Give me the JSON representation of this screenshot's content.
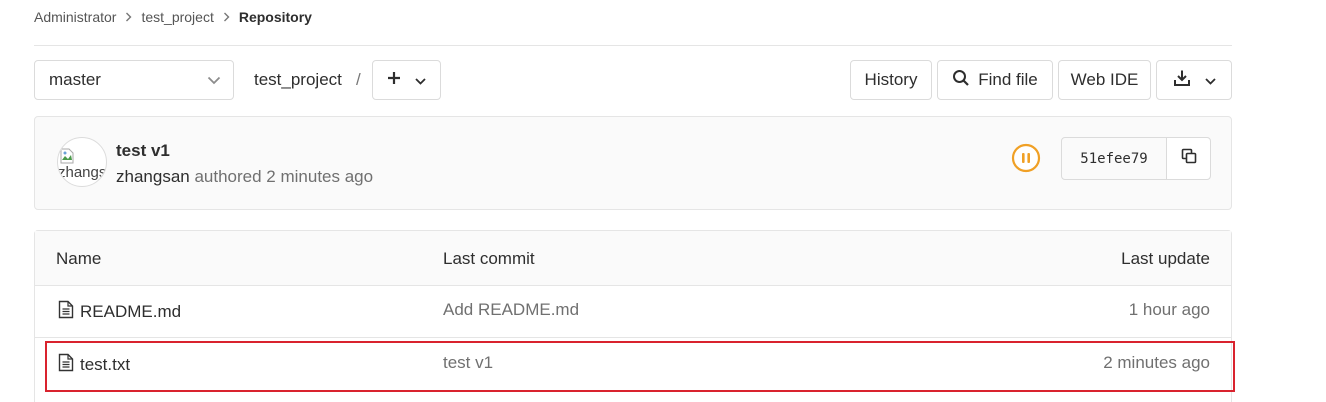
{
  "breadcrumb": {
    "items": [
      "Administrator",
      "test_project"
    ],
    "current": "Repository"
  },
  "toolbar": {
    "branch": "master",
    "project_path": "test_project",
    "path_separator": "/",
    "history_label": "History",
    "find_file_label": "Find file",
    "web_ide_label": "Web IDE"
  },
  "commit": {
    "title": "test v1",
    "author": "zhangsan",
    "authored_text": "authored 2 minutes ago",
    "avatar_alt": "zhangsan",
    "sha": "51efee79",
    "pipeline_status_color": "#f0a025"
  },
  "table": {
    "headers": {
      "name": "Name",
      "last_commit": "Last commit",
      "last_update": "Last update"
    },
    "rows": [
      {
        "name": "README.md",
        "last_commit": "Add README.md",
        "last_update": "1 hour ago"
      },
      {
        "name": "test.txt",
        "last_commit": "test v1",
        "last_update": "2 minutes ago"
      }
    ],
    "highlight_color": "#d9232e"
  }
}
